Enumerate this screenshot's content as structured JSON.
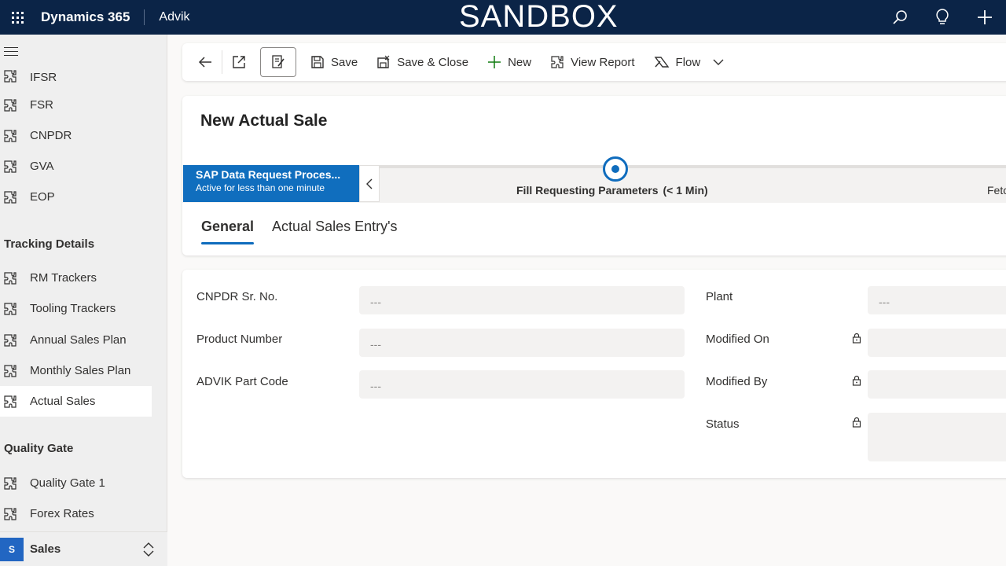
{
  "topbar": {
    "app_title": "Dynamics 365",
    "org_name": "Advik",
    "environment_banner": "SANDBOX",
    "icons": [
      "waffle-icon",
      "search-icon",
      "lightbulb-icon",
      "plus-icon"
    ]
  },
  "sidebar": {
    "partial_item": "IFSR",
    "items_group1": [
      {
        "label": "FSR"
      },
      {
        "label": "CNPDR"
      },
      {
        "label": "GVA"
      },
      {
        "label": "EOP"
      }
    ],
    "tracking_header": "Tracking Details",
    "items_tracking": [
      {
        "label": "RM Trackers"
      },
      {
        "label": "Tooling Trackers"
      },
      {
        "label": "Annual Sales Plan"
      },
      {
        "label": "Monthly Sales Plan"
      },
      {
        "label": "Actual Sales",
        "active": true
      }
    ],
    "quality_header": "Quality Gate",
    "items_quality": [
      {
        "label": "Quality Gate 1"
      },
      {
        "label": "Forex Rates"
      }
    ],
    "area": {
      "badge": "S",
      "label": "Sales"
    }
  },
  "commandbar": {
    "save": "Save",
    "save_close": "Save & Close",
    "new": "New",
    "view_report": "View Report",
    "flow": "Flow"
  },
  "record": {
    "title": "New Actual Sale",
    "bpf": {
      "process_name": "SAP Data Request Proces...",
      "process_status": "Active for less than one minute",
      "active_stage": "Fill Requesting Parameters",
      "active_stage_duration": "(< 1 Min)",
      "next_stage_partial": "Fetc"
    },
    "tabs": [
      {
        "label": "General",
        "active": true
      },
      {
        "label": "Actual Sales Entry's"
      }
    ]
  },
  "form": {
    "left_fields": [
      {
        "label": "CNPDR Sr. No.",
        "value": "---"
      },
      {
        "label": "Product Number",
        "value": "---"
      },
      {
        "label": "ADVIK Part Code",
        "value": "---"
      }
    ],
    "right_fields": [
      {
        "label": "Plant",
        "value": "---",
        "locked": false
      },
      {
        "label": "Modified On",
        "value": "",
        "locked": true
      },
      {
        "label": "Modified By",
        "value": "",
        "locked": true
      },
      {
        "label": "Status",
        "value": "",
        "locked": true
      }
    ]
  },
  "colors": {
    "topbar_bg": "#0b2447",
    "accent": "#0f6cbd",
    "bpf_active_bg": "#106ebe",
    "sidebar_bg": "#efefef"
  }
}
